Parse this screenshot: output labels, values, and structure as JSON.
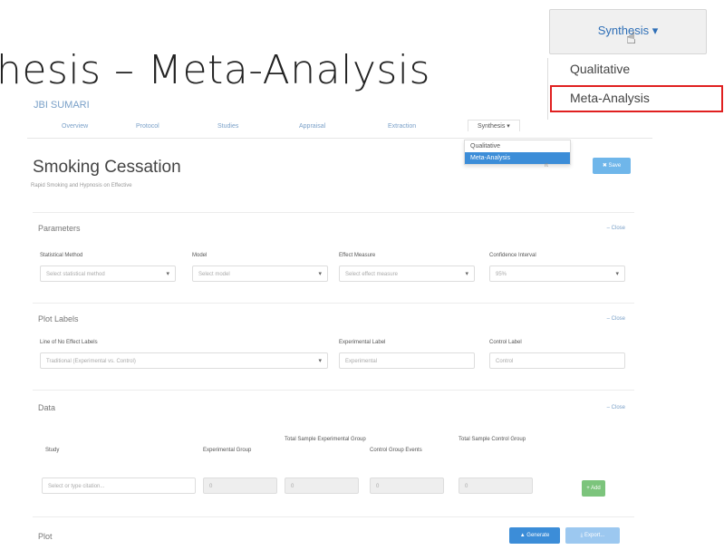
{
  "slide": {
    "title": "hesis – Meta-Analysis"
  },
  "app": {
    "brand": "JBI",
    "brand_sub": "SUMARI",
    "nav": [
      "Overview",
      "Protocol",
      "Studies",
      "Appraisal",
      "Extraction",
      "Synthesis ▾"
    ],
    "mini_dropdown": [
      "Qualitative",
      "Meta-Analysis"
    ],
    "title": "Smoking Cessation",
    "subtitle": "Rapid Smoking and Hypnosis on Effective",
    "share_label": "rt",
    "save_label": "✖ Save"
  },
  "parameters": {
    "title": "Parameters",
    "close": "– Close",
    "fields": [
      {
        "label": "Statistical Method",
        "placeholder": "Select statistical method"
      },
      {
        "label": "Model",
        "placeholder": "Select model"
      },
      {
        "label": "Effect Measure",
        "placeholder": "Select effect measure"
      },
      {
        "label": "Confidence Interval",
        "value": "95%"
      }
    ]
  },
  "plot_labels": {
    "title": "Plot Labels",
    "close": "– Close",
    "line_label": "Line of No Effect Labels",
    "line_value": "Traditional (Experimental vs. Control)",
    "exp_label": "Experimental Label",
    "exp_value": "Experimental",
    "ctrl_label": "Control Label",
    "ctrl_value": "Control"
  },
  "data_panel": {
    "title": "Data",
    "close": "– Close",
    "headers": [
      "Study",
      "Experimental Group",
      "Total Sample Experimental Group",
      "Control Group Events",
      "Total Sample Control Group"
    ],
    "study_placeholder": "Select or type citation...",
    "zero": "0",
    "add_label": "+ Add"
  },
  "plot": {
    "title": "Plot",
    "generate_label": "▲ Generate",
    "export_label": "⤓ Export..."
  },
  "callout": {
    "button": "Synthesis ▾",
    "items": [
      "Qualitative",
      "Meta-Analysis"
    ],
    "highlight_color": "#e02020"
  }
}
